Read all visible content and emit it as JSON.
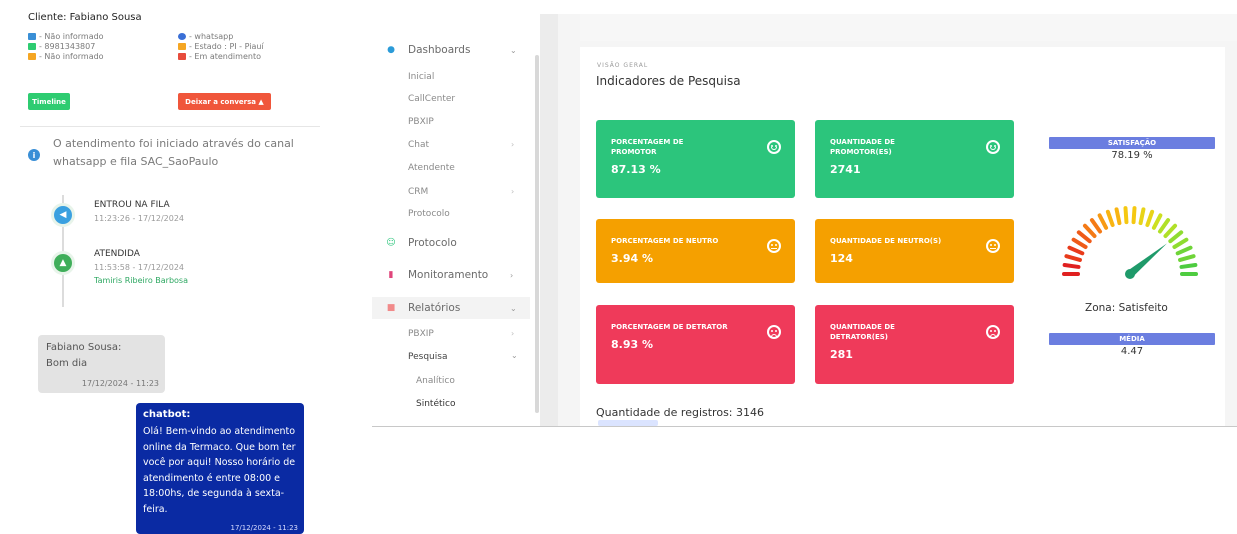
{
  "client": {
    "title": "Cliente: Fabiano Sousa",
    "email": "- Não informado",
    "phone": "- 8981343807",
    "company": "- Não informado",
    "channel": "- whatsapp",
    "state": "- Estado : PI - Piauí",
    "status": "- Em atendimento",
    "timeline_btn": "Timeline",
    "leave_btn": "Deixar a conversa ▲"
  },
  "attendance_info": "O atendimento foi iniciado através do canal whatsapp e fila SAC_SaoPaulo",
  "timeline": [
    {
      "title": "ENTROU NA FILA",
      "time": "11:23:26 - 17/12/2024",
      "agent": ""
    },
    {
      "title": "ATENDIDA",
      "time": "11:53:58 - 17/12/2024",
      "agent": "Tamiris Ribeiro Barbosa"
    }
  ],
  "messages": {
    "incoming": {
      "author": "Fabiano Sousa:",
      "text": "Bom dia",
      "time": "17/12/2024 - 11:23"
    },
    "outgoing": {
      "author": "chatbot:",
      "text": "Olá! Bem-vindo ao atendimento online da Termaco. Que bom ter você por aqui! Nosso horário de atendimento é entre 08:00 e 18:00hs, de segunda à sexta-feira.",
      "time": "17/12/2024 - 11:23"
    }
  },
  "sidebar": {
    "dashboards": "Dashboards",
    "dash_items": [
      "Inicial",
      "CallCenter",
      "PBXIP",
      "Chat",
      "Atendente",
      "CRM",
      "Protocolo"
    ],
    "protocolo": "Protocolo",
    "monitoramento": "Monitoramento",
    "relatorios": "Relatórios",
    "rel_pbxip": "PBXIP",
    "rel_pesquisa": "Pesquisa",
    "pesq_items": [
      "Analítico",
      "Sintético"
    ]
  },
  "dashboard": {
    "eyebrow": "VISÃO GERAL",
    "title": "Indicadores de Pesquisa",
    "kpis": [
      {
        "label": "PORCENTAGEM DE PROMOTOR",
        "value": "87.13 %",
        "mood": "happy",
        "color": "#2cc57c"
      },
      {
        "label": "QUANTIDADE DE PROMOTOR(ES)",
        "value": "2741",
        "mood": "happy",
        "color": "#2cc57c"
      },
      {
        "label": "PORCENTAGEM DE NEUTRO",
        "value": "3.94 %",
        "mood": "neutral",
        "color": "#f5a000"
      },
      {
        "label": "QUANTIDADE DE NEUTRO(S)",
        "value": "124",
        "mood": "neutral",
        "color": "#f5a000"
      },
      {
        "label": "PORCENTAGEM DE DETRATOR",
        "value": "8.93 %",
        "mood": "sad",
        "color": "#ef3a5a"
      },
      {
        "label": "QUANTIDADE DE DETRATOR(ES)",
        "value": "281",
        "mood": "sad",
        "color": "#ef3a5a"
      }
    ],
    "satisfacao_label": "SATISFAÇÃO",
    "satisfacao_value": "78.19 %",
    "gauge_level": 0.78,
    "zona": "Zona: Satisfeito",
    "media_label": "MÉDIA",
    "media_value": "4.47",
    "registros": "Quantidade de registros: 3146"
  }
}
